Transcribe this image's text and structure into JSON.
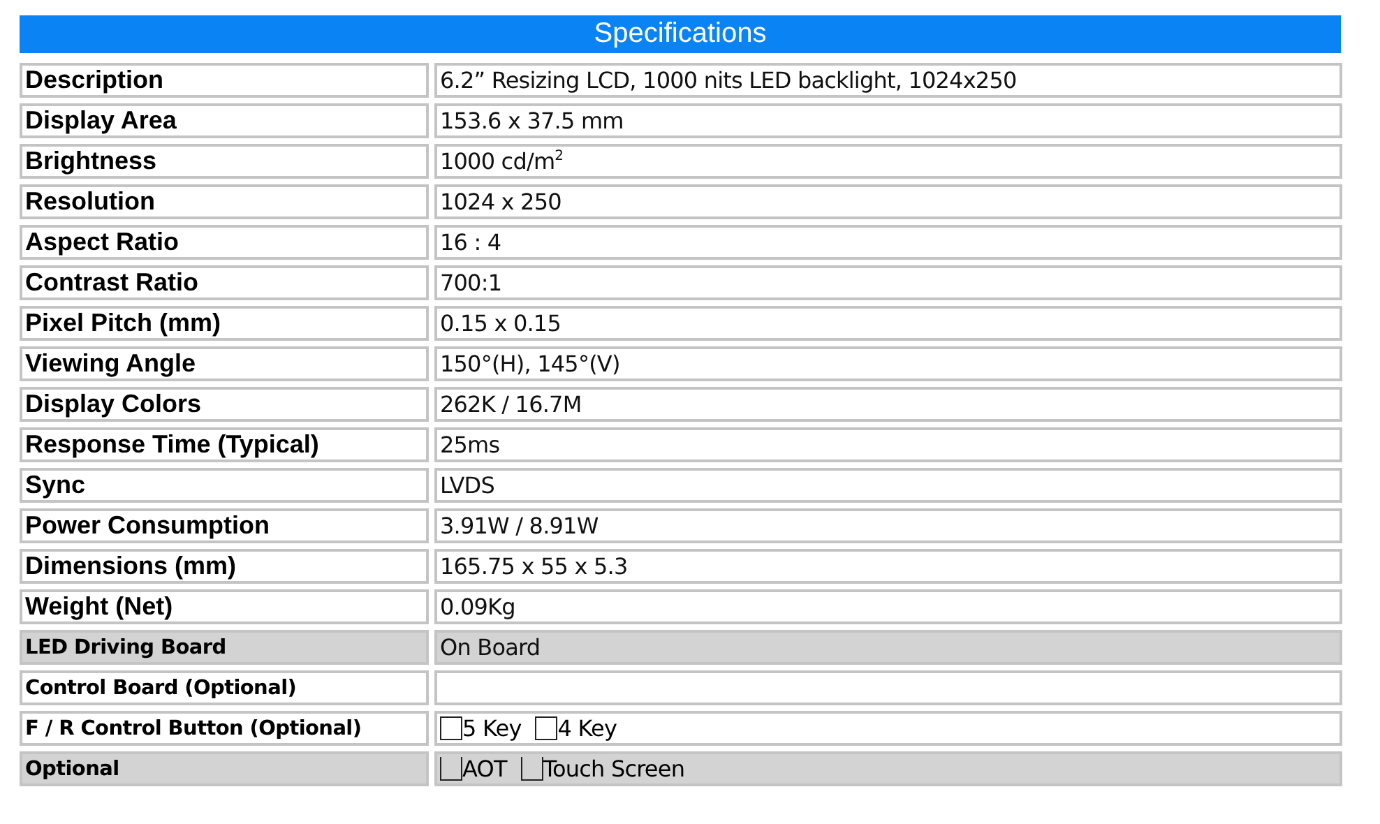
{
  "title": "Specifications",
  "rows": [
    {
      "label": "Description",
      "kind": "primary",
      "shaded": false,
      "value": "6.2” Resizing LCD, 1000 nits LED backlight, 1024x250"
    },
    {
      "label": "Display Area",
      "kind": "primary",
      "shaded": false,
      "value": "153.6 x 37.5 mm"
    },
    {
      "label": "Brightness",
      "kind": "primary",
      "shaded": false,
      "value": "1000 cd/m$^{2}$"
    },
    {
      "label": "Resolution",
      "kind": "primary",
      "shaded": false,
      "value": "1024 x 250"
    },
    {
      "label": "Aspect Ratio",
      "kind": "primary",
      "shaded": false,
      "value": "16 : 4"
    },
    {
      "label": "Contrast Ratio",
      "kind": "primary",
      "shaded": false,
      "value": "700:1"
    },
    {
      "label": "Pixel Pitch (mm)",
      "kind": "primary",
      "shaded": false,
      "value": "0.15 x 0.15"
    },
    {
      "label": "Viewing Angle",
      "kind": "primary",
      "shaded": false,
      "value": "150°(H), 145°(V)"
    },
    {
      "label": "Display Colors",
      "kind": "primary",
      "shaded": false,
      "value": "262K / 16.7M"
    },
    {
      "label": "Response Time (Typical)",
      "kind": "primary",
      "shaded": false,
      "value": "25ms"
    },
    {
      "label": "Sync",
      "kind": "primary",
      "shaded": false,
      "value": "LVDS"
    },
    {
      "label": "Power Consumption",
      "kind": "primary",
      "shaded": false,
      "value": "3.91W / 8.91W"
    },
    {
      "label": "Dimensions (mm)",
      "kind": "primary",
      "shaded": false,
      "value": "165.75 x 55 x 5.3"
    },
    {
      "label": "Weight (Net)",
      "kind": "primary",
      "shaded": false,
      "value": "0.09Kg"
    },
    {
      "label": "LED Driving Board",
      "kind": "secondary",
      "shaded": true,
      "value": "On Board"
    },
    {
      "label": "Control Board (Optional)",
      "kind": "secondary",
      "shaded": false
    },
    {
      "label": "F / R Control Button (Optional)",
      "kind": "secondary",
      "shaded": false,
      "options": [
        {
          "label": "5 Key",
          "checked": false,
          "kind": "box"
        },
        {
          "label": "4 Key",
          "checked": false,
          "kind": "box"
        }
      ]
    },
    {
      "label": "Optional",
      "kind": "secondary",
      "shaded": true,
      "options": [
        {
          "label": "AOT",
          "checked": false,
          "kind": "open"
        },
        {
          "label": "Touch Screen",
          "checked": false,
          "kind": "open"
        }
      ]
    }
  ]
}
